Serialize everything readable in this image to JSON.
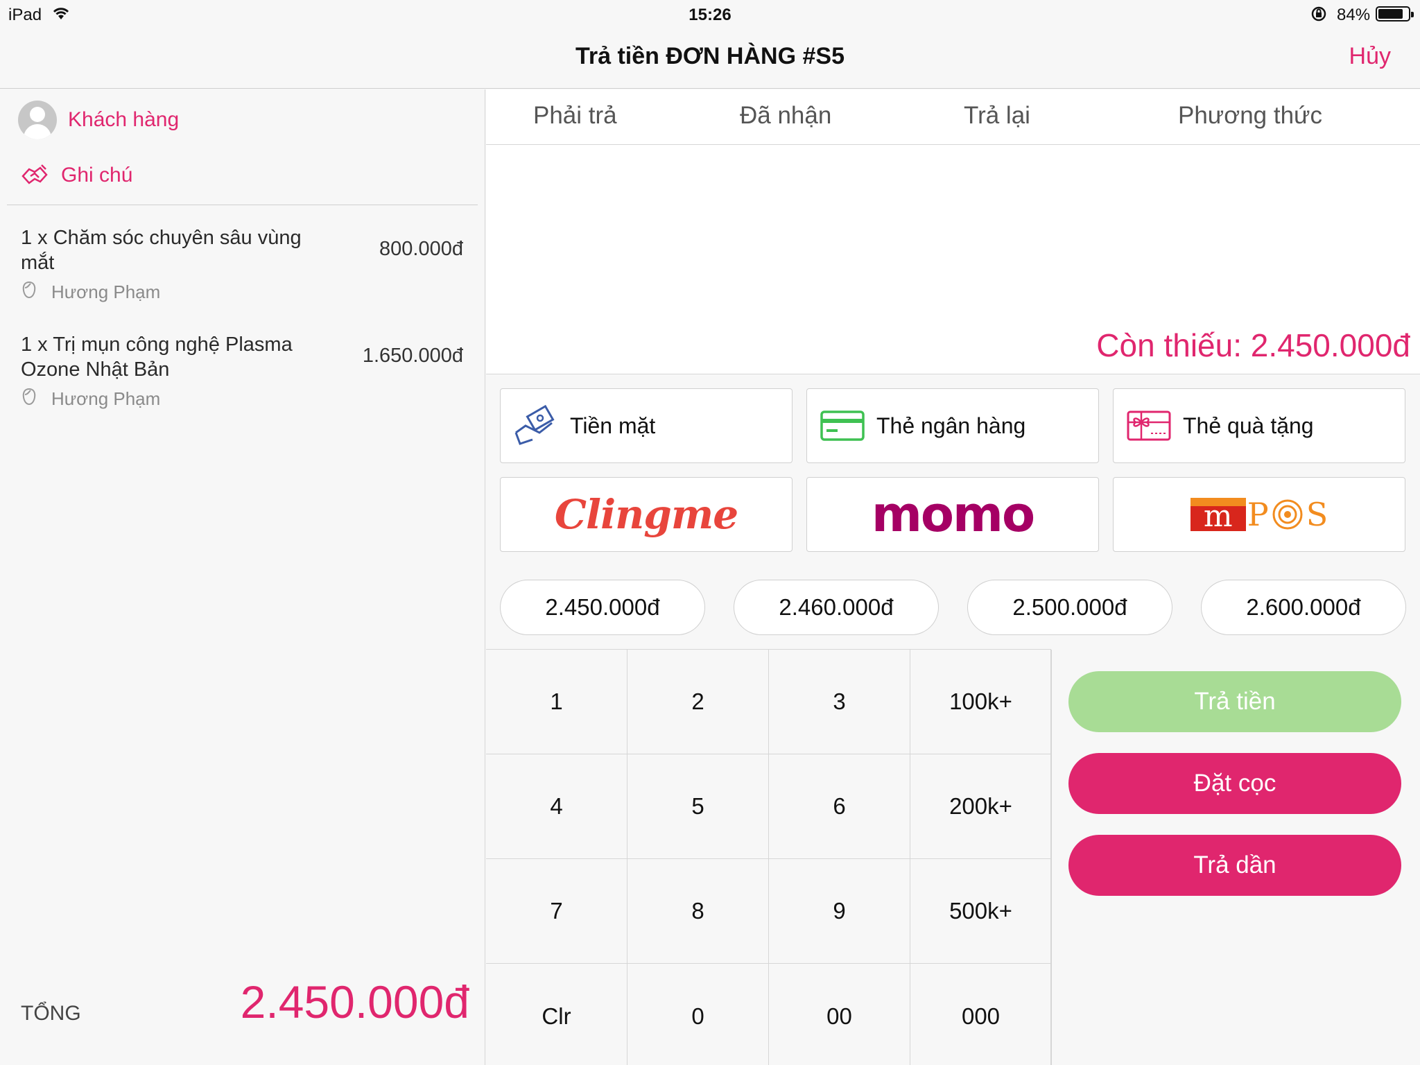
{
  "status_bar": {
    "device": "iPad",
    "time": "15:26",
    "battery": "84%",
    "battery_level": 0.84
  },
  "nav": {
    "title": "Trả tiền ĐƠN HÀNG #S5",
    "cancel": "Hủy"
  },
  "left": {
    "customer_label": "Khách hàng",
    "note_label": "Ghi chú",
    "items": [
      {
        "name": "1 x Chăm sóc chuyên sâu vùng mắt",
        "price": "800.000đ",
        "staff": "Hương Phạm"
      },
      {
        "name": "1 x Trị mụn công nghệ Plasma Ozone Nhật Bản",
        "price": "1.650.000đ",
        "staff": "Hương Phạm"
      }
    ],
    "total_label": "TỔNG",
    "total_value": "2.450.000đ"
  },
  "right": {
    "tabs": [
      "Phải trả",
      "Đã nhận",
      "Trả lại",
      "Phương thức"
    ],
    "remaining": "Còn thiếu: 2.450.000đ",
    "methods": [
      "Tiền mặt",
      "Thẻ ngân hàng",
      "Thẻ quà tặng"
    ],
    "logos": {
      "clingme": "Clingme",
      "momo": "momo",
      "mpos_m": "m",
      "mpos_p": "P",
      "mpos_s": "S"
    },
    "quick_amounts": [
      "2.450.000đ",
      "2.460.000đ",
      "2.500.000đ",
      "2.600.000đ"
    ],
    "keypad": [
      "1",
      "2",
      "3",
      "100k+",
      "4",
      "5",
      "6",
      "200k+",
      "7",
      "8",
      "9",
      "500k+",
      "Clr",
      "0",
      "00",
      "000"
    ],
    "actions": {
      "pay": "Trả tiền",
      "deposit": "Đặt cọc",
      "partial": "Trả dần"
    },
    "colors": {
      "accent": "#e0266e",
      "pay_disabled": "#a8dc95",
      "momo": "#a50064",
      "clingme": "#e8453c",
      "mpos_red": "#d8261c",
      "mpos_orange": "#f28c1f"
    }
  }
}
